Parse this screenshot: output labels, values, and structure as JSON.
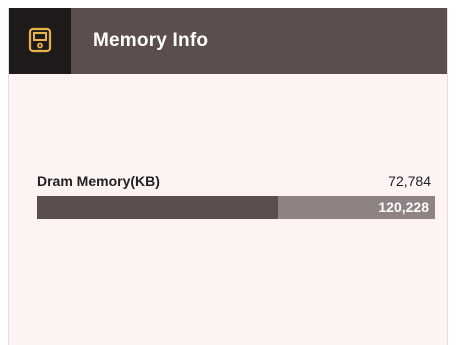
{
  "header": {
    "icon": "memory-card-icon",
    "title": "Memory Info"
  },
  "memory": {
    "label": "Dram Memory(KB)",
    "used": "72,784",
    "total": "120,228",
    "used_fraction": 0.6054
  },
  "colors": {
    "header_bg": "#5d4e4e",
    "icon_tile_bg": "#201b1b",
    "icon_accent": "#e8b24a",
    "page_bg": "#fdf3f3",
    "bar_used": "#5d4e4e",
    "bar_total": "#8e8282"
  }
}
